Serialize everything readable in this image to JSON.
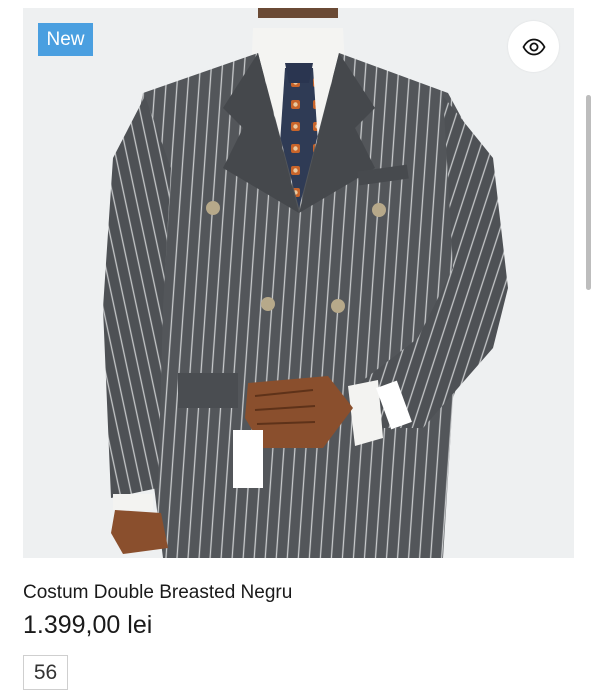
{
  "product": {
    "badge": "New",
    "title": "Costum Double Breasted Negru",
    "price": "1.399,00 lei",
    "sizes": [
      "56"
    ],
    "image_alt": "Striped double breasted suit on mannequin",
    "quick_view_icon": "eye-icon"
  },
  "colors": {
    "badge_bg": "#4a9fe0",
    "suit": "#505356",
    "background": "#eef0f1"
  }
}
